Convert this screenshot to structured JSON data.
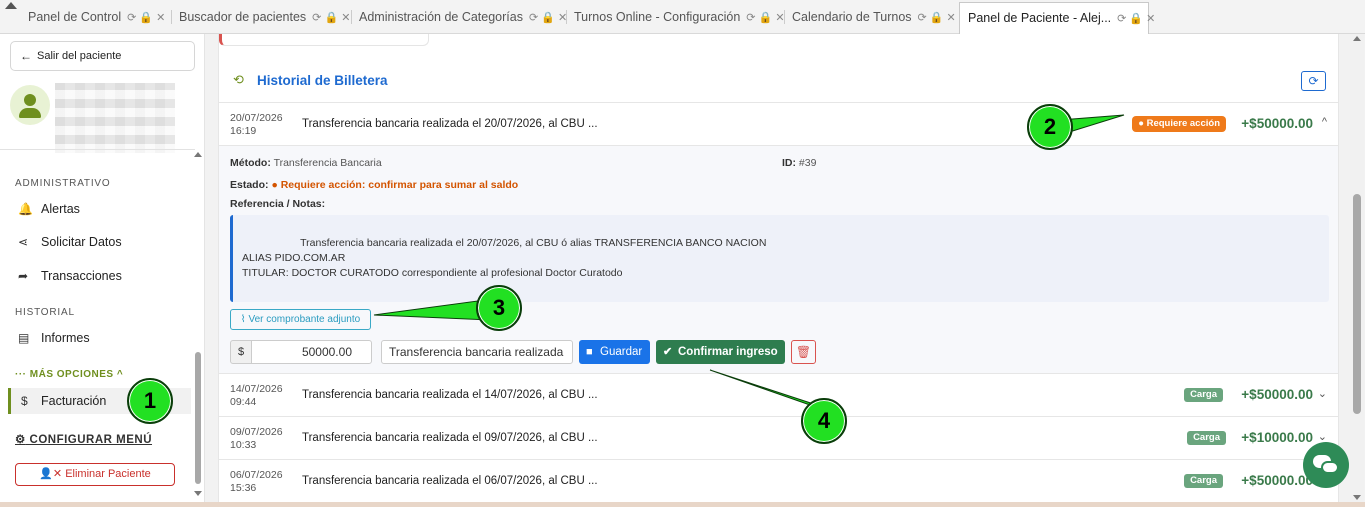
{
  "tabs": [
    {
      "label": "Panel de Control"
    },
    {
      "label": "Buscador de pacientes"
    },
    {
      "label": "Administración de Categorías"
    },
    {
      "label": "Turnos Online - Configuración"
    },
    {
      "label": "Calendario de Turnos"
    },
    {
      "label": "Panel de Paciente - Alej..."
    }
  ],
  "sidebar": {
    "exit_label": "Salir del paciente",
    "section_admin": "ADMINISTRATIVO",
    "items_admin": [
      {
        "label": "Alertas",
        "icon": "bell-icon"
      },
      {
        "label": "Solicitar Datos",
        "icon": "share-icon"
      },
      {
        "label": "Transacciones",
        "icon": "forward-icon"
      }
    ],
    "section_hist": "HISTORIAL",
    "items_hist": [
      {
        "label": "Informes",
        "icon": "file-icon"
      }
    ],
    "more_label": "MÁS OPCIONES",
    "active_item": {
      "label": "Facturación",
      "icon": "dollar-icon"
    },
    "config_label": "CONFIGURAR MENÚ",
    "delete_label": "Eliminar Paciente"
  },
  "wallet": {
    "title": "Historial de Billetera",
    "rows": [
      {
        "date": "20/07/2026",
        "time": "16:19",
        "desc": "Transferencia bancaria realizada el 20/07/2026, al CBU ...",
        "badge": "Requiere acción",
        "amount": "+$50000.00",
        "expanded": true
      },
      {
        "date": "14/07/2026",
        "time": "09:44",
        "desc": "Transferencia bancaria realizada el 14/07/2026, al CBU ...",
        "badge": "Carga",
        "amount": "+$50000.00"
      },
      {
        "date": "09/07/2026",
        "time": "10:33",
        "desc": "Transferencia bancaria realizada el 09/07/2026, al CBU ...",
        "badge": "Carga",
        "amount": "+$10000.00"
      },
      {
        "date": "06/07/2026",
        "time": "15:36",
        "desc": "Transferencia bancaria realizada el 06/07/2026, al CBU ...",
        "badge": "Carga",
        "amount": "+$50000.00"
      }
    ],
    "detail": {
      "method_label": "Método:",
      "method_value": "Transferencia Bancaria",
      "id_label": "ID:",
      "id_value": "#39",
      "state_label": "Estado:",
      "state_value": "Requiere acción: confirmar para sumar al saldo",
      "notes_label": "Referencia / Notas:",
      "notes_text": "                    Transferencia bancaria realizada el 20/07/2026, al CBU ó alias TRANSFERENCIA BANCO NACION\nALIAS PIDO.COM.AR\nTITULAR: DOCTOR CURATODO correspondiente al profesional Doctor Curatodo",
      "view_receipt": "Ver comprobante adjunto",
      "currency": "$",
      "amount_value": "50000.00",
      "desc_value": "Transferencia bancaria realizada",
      "save_label": "Guardar",
      "confirm_label": "Confirmar ingreso"
    }
  },
  "callouts": [
    "1",
    "2",
    "3",
    "4"
  ],
  "colors": {
    "accent": "#6f8f1f",
    "blue": "#1e6ad0",
    "green": "#2e7d4f",
    "orange": "#ef7a1a",
    "callout": "#22e022"
  }
}
